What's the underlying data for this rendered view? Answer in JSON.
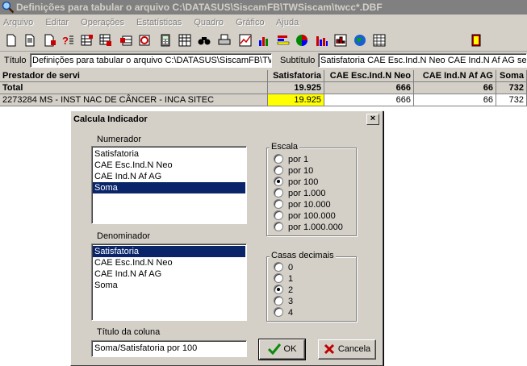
{
  "window": {
    "title": "Definições para tabular o arquivo C:\\DATASUS\\SiscamFB\\TWSiscam\\twcc*.DBF"
  },
  "menu": [
    "Arquivo",
    "Editar",
    "Operações",
    "Estatísticas",
    "Quadro",
    "Gráfico",
    "Ajuda"
  ],
  "toolbar": {
    "icons": [
      "new-doc-icon",
      "open-doc-icon",
      "doc-edit-icon",
      "help-icon",
      "table-icon",
      "table-edit-icon",
      "table-link-icon",
      "table-refresh-icon",
      "calculator-icon",
      "sheet-icon",
      "binoculars-icon",
      "print-icon",
      "line-chart-icon",
      "bar-chart-icon",
      "horizontal-bar-icon",
      "pie-chart-icon",
      "column-chart-icon",
      "histogram-icon",
      "globe-icon",
      "grid-icon",
      "exit-door-icon"
    ]
  },
  "titulo": {
    "label": "Título",
    "value": "Definições para tabular o arquivo C:\\DATASUS\\SiscamFB\\TW",
    "subtitle_label": "Subtítulo",
    "subtitle_value": "Satisfatoria CAE Esc.Ind.N Neo CAE Ind.N Af AG seg"
  },
  "grid": {
    "headers": [
      "Prestador de servi",
      "Satisfatoria",
      "CAE Esc.Ind.N Neo",
      "CAE Ind.N Af AG",
      "Soma"
    ],
    "total": [
      "Total",
      "19.925",
      "666",
      "66",
      "732"
    ],
    "rows": [
      [
        "2273284 MS - INST NAC DE CÂNCER - INCA SITEC",
        "19.925",
        "666",
        "66",
        "732"
      ]
    ]
  },
  "dialog": {
    "title": "Calcula Indicador",
    "close": "×",
    "numerador_label": "Numerador",
    "numerador_items": [
      "Satisfatoria",
      "CAE Esc.Ind.N Neo",
      "CAE Ind.N Af AG",
      "Soma"
    ],
    "numerador_selected": 3,
    "denominador_label": "Denominador",
    "denominador_items": [
      "Satisfatoria",
      "CAE Esc.Ind.N Neo",
      "CAE Ind.N Af AG",
      "Soma"
    ],
    "denominador_selected": 0,
    "escala_label": "Escala",
    "escala_options": [
      "por 1",
      "por 10",
      "por 100",
      "por 1.000",
      "por 10.000",
      "por 100.000",
      "por 1.000.000"
    ],
    "escala_selected": 2,
    "casas_label": "Casas decimais",
    "casas_options": [
      "0",
      "1",
      "2",
      "3",
      "4"
    ],
    "casas_selected": 2,
    "titulo_coluna_label": "Título da coluna",
    "titulo_coluna_value": "Soma/Satisfatoria por 100",
    "ok_label": "OK",
    "cancel_label": "Cancela"
  }
}
